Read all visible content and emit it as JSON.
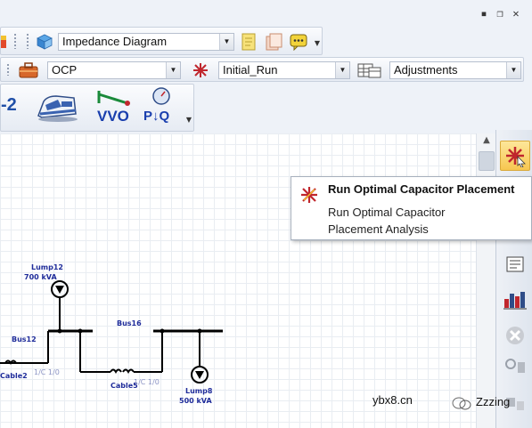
{
  "window_controls": {
    "minimize": "▪",
    "restore": "❐",
    "close": "✕"
  },
  "toolbar1": {
    "diagram_combo": {
      "value": "Impedance Diagram"
    }
  },
  "toolbar2": {
    "study_combo": {
      "value": "OCP"
    },
    "run_combo": {
      "value": "Initial_Run"
    },
    "adjust_combo": {
      "value": "Adjustments"
    }
  },
  "toolbar3": {
    "partial_label": "-2",
    "vvo_label": "VVO",
    "pq_label": "P↓Q"
  },
  "tooltip": {
    "title": "Run Optimal Capacitor Placement",
    "description": "Run Optimal Capacitor Placement Analysis"
  },
  "diagram": {
    "lump12": {
      "name": "Lump12",
      "rating": "700 kVA"
    },
    "bus12": {
      "name": "Bus12"
    },
    "bus16": {
      "name": "Bus16"
    },
    "cable2": {
      "name": "Cable2"
    },
    "cable5": {
      "name": "Cable5"
    },
    "lump8": {
      "name": "Lump8",
      "rating": "500 kVA"
    },
    "conn_label_1": "1/C 1/0",
    "conn_label_2": "1/C 1/0"
  },
  "watermark": {
    "site": "ybx8.cn",
    "brand": "Zzzing"
  },
  "colors": {
    "accent_blue": "#1f2c9a",
    "tooltip_highlight": "#f7c650"
  }
}
